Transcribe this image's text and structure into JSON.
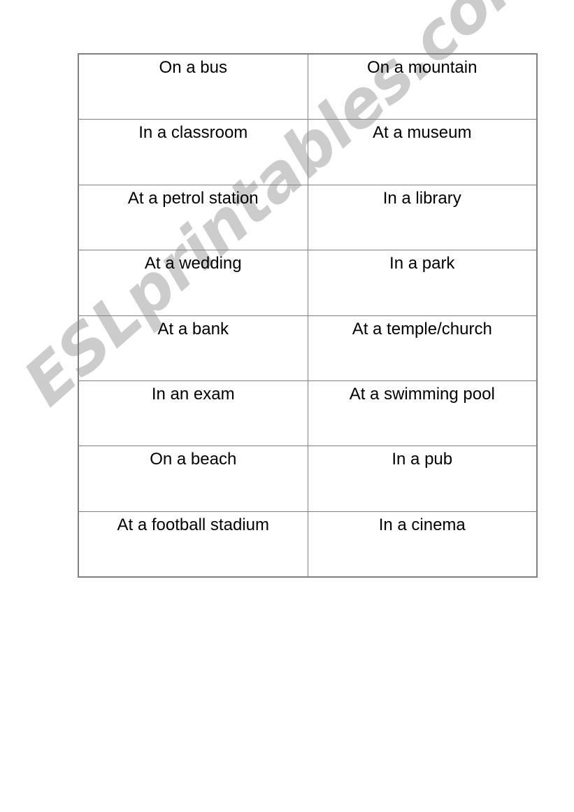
{
  "document": {
    "type": "worksheet-cards",
    "background_color": "#ffffff",
    "text_color": "#000000",
    "border_color": "#808080"
  },
  "watermark": {
    "text": "ESLprintables.com",
    "color": "#cccccc",
    "rotation_degrees": -41.5
  },
  "table": {
    "columns": 2,
    "row_count": 8,
    "rows": [
      {
        "left": "On a bus",
        "right": "On a mountain"
      },
      {
        "left": "In a classroom",
        "right": "At a museum"
      },
      {
        "left": "At a petrol station",
        "right": "In a library"
      },
      {
        "left": "At a wedding",
        "right": "In a park"
      },
      {
        "left": "At a bank",
        "right": "At a temple/church"
      },
      {
        "left": "In an exam",
        "right": "At a swimming pool"
      },
      {
        "left": "On a beach",
        "right": "In a pub"
      },
      {
        "left": "At a football stadium",
        "right": "In a cinema"
      }
    ]
  }
}
